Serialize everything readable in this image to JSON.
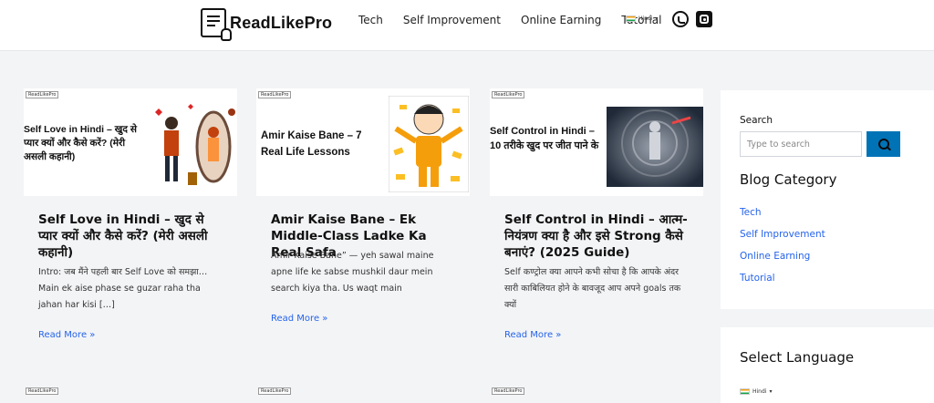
{
  "brand": {
    "name": "ReadLikePro"
  },
  "nav": {
    "items": [
      "Tech",
      "Self Improvement",
      "Online Earning",
      "Tutorial"
    ],
    "language": "Hindi"
  },
  "thumb_badge": "ReadLikePro",
  "posts": [
    {
      "thumb_title": "Self Love in Hindi – खुद से प्यार क्यों और कैसे करें? (मेरी असली कहानी)",
      "title": "Self Love in Hindi – खुद से प्यार क्यों और कैसे करें? (मेरी असली कहानी)",
      "excerpt": "Intro: जब मैंने पहली बार Self Love को समझा… Main ek aise phase se guzar raha tha jahan har kisi […]",
      "read_more": "Read More »"
    },
    {
      "thumb_title": "Amir Kaise Bane – 7 Real Life Lessons",
      "title": "Amir Kaise Bane – Ek Middle-Class Ladke Ka Real Safa",
      "excerpt": "Amir Kaise Bane” — yeh sawal maine apne life ke sabse mushkil daur mein search kiya tha. Us waqt main",
      "read_more": "Read More »"
    },
    {
      "thumb_title": "Self Control in Hindi – 10 तरीके खुद पर जीत पाने के",
      "title": "Self Control in Hindi – आत्म-नियंत्रण क्या है और इसे Strong कैसे बनाएं? (2025 Guide)",
      "excerpt": "Self कण्ट्रोल क्या आपने कभी सोचा है कि आपके अंदर सारी काबिलियत होने के बावजूद आप अपने goals तक क्यों",
      "read_more": "Read More »"
    }
  ],
  "sidebar": {
    "search_label": "Search",
    "search_placeholder": "Type to search",
    "category_heading": "Blog Category",
    "categories": [
      "Tech",
      "Self Improvement",
      "Online Earning",
      "Tutorial"
    ],
    "language_heading": "Select Language",
    "language_value": "Hindi"
  },
  "colors": {
    "accent": "#0073b7",
    "link": "#2563eb"
  }
}
